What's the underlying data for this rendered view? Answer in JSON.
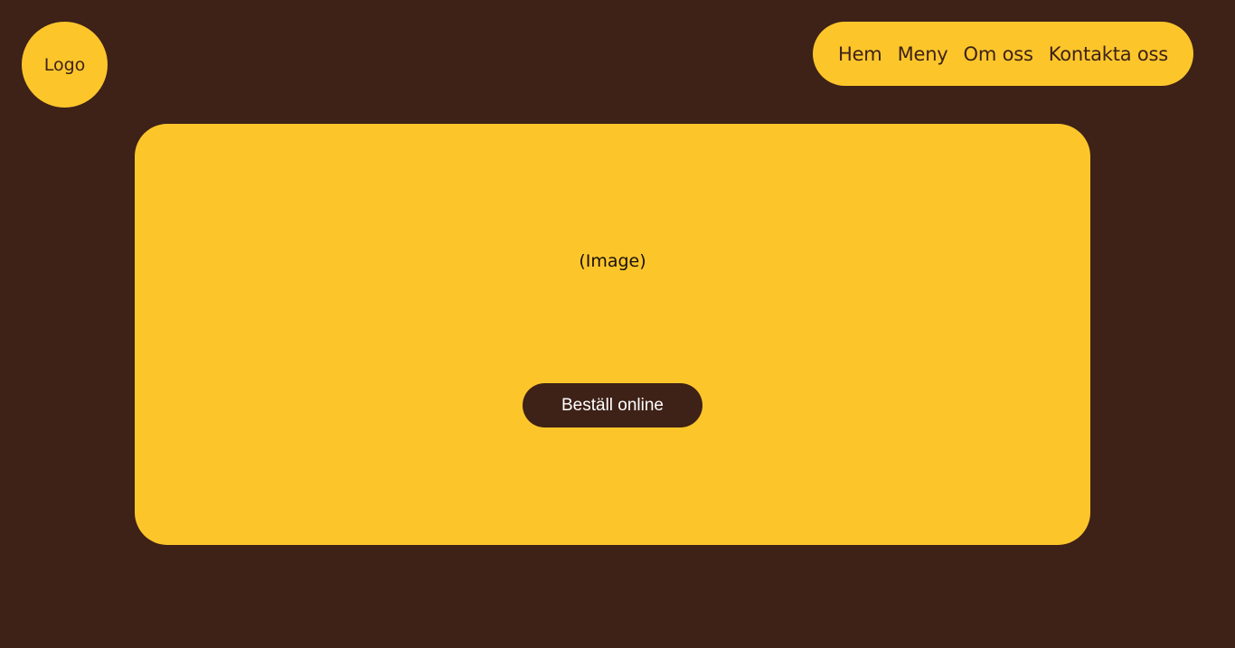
{
  "header": {
    "logo_label": "Logo",
    "nav": [
      {
        "label": "Hem"
      },
      {
        "label": "Meny"
      },
      {
        "label": "Om oss"
      },
      {
        "label": "Kontakta oss"
      }
    ]
  },
  "hero": {
    "image_label": "(Image)",
    "cta_label": "Beställ online"
  },
  "colors": {
    "background": "#3e2117",
    "accent": "#fcc62b",
    "button_text": "#ffffff"
  }
}
